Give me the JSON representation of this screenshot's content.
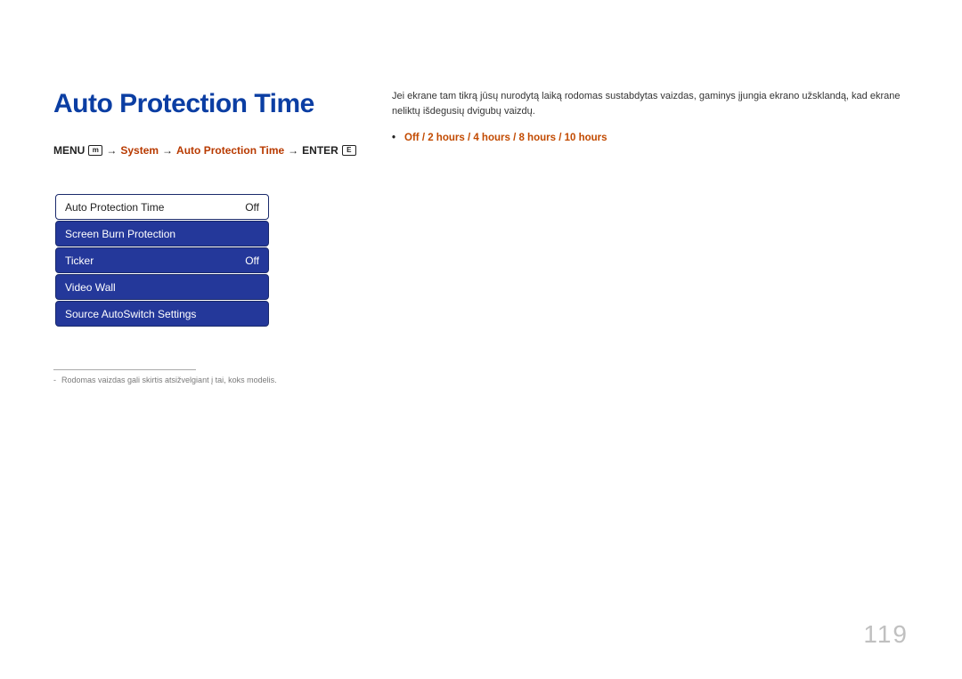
{
  "title": "Auto Protection Time",
  "breadcrumb": {
    "menu_label": "MENU",
    "menu_icon": "m",
    "arrow": "→",
    "system": "System",
    "auto_protection": "Auto Protection Time",
    "enter_label": "ENTER",
    "enter_icon": "E"
  },
  "menu": {
    "items": [
      {
        "label": "Auto Protection Time",
        "value": "Off",
        "selected": true
      },
      {
        "label": "Screen Burn Protection",
        "value": "",
        "selected": false
      },
      {
        "label": "Ticker",
        "value": "Off",
        "selected": false
      },
      {
        "label": "Video Wall",
        "value": "",
        "selected": false
      },
      {
        "label": "Source AutoSwitch Settings",
        "value": "",
        "selected": false
      }
    ]
  },
  "footnote": {
    "dash": "-",
    "text": "Rodomas vaizdas gali skirtis atsižvelgiant į tai, koks modelis."
  },
  "description": "Jei ekrane tam tikrą jūsų nurodytą laiką rodomas sustabdytas vaizdas, gaminys įjungia ekrano užsklandą, kad ekrane neliktų išdegusių dvigubų vaizdų.",
  "options": {
    "bullet": "•",
    "items": [
      "Off",
      "2 hours",
      "4 hours",
      "8 hours",
      "10 hours"
    ],
    "sep": " / "
  },
  "page_number": "119"
}
